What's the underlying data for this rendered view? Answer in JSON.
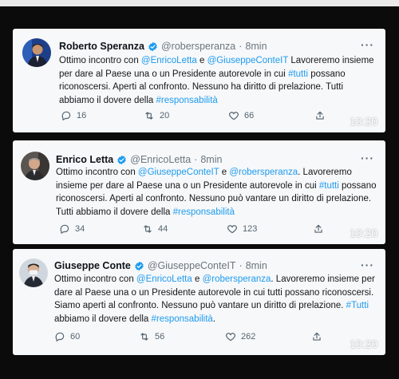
{
  "tweets": [
    {
      "name": "Roberto Speranza",
      "handle": "@robersperanza",
      "dot": "·",
      "age": "8min",
      "more": "···",
      "text": {
        "p1": "Ottimo incontro con ",
        "m1": "@EnricoLetta",
        "p2": " e ",
        "m2": "@GiuseppeConteIT",
        "p3": " Lavoreremo insieme per dare al Paese una o un Presidente autorevole in cui ",
        "h1": "#tutti",
        "p4": " possano riconoscersi. Aperti al confronto. Nessuno ha diritto di prelazione. Tutti abbiamo il dovere della ",
        "h2": "#responsabilità"
      },
      "replies": "16",
      "retweets": "20",
      "likes": "66",
      "timestamp": "10:20"
    },
    {
      "name": "Enrico Letta",
      "handle": "@EnricoLetta",
      "dot": "·",
      "age": "8min",
      "more": "···",
      "text": {
        "p1": "Ottimo incontro con ",
        "m1": "@GiuseppeConteIT",
        "p2": " e ",
        "m2": "@robersperanza",
        "p3": ". Lavoreremo insieme per dare al Paese una o un Presidente autorevole in cui ",
        "h1": "#tutti",
        "p4": " possano riconoscersi. Aperti al confronto. Nessuno può vantare un diritto di prelazione. Tutti abbiamo il dovere della ",
        "h2": "#responsabilità"
      },
      "replies": "34",
      "retweets": "44",
      "likes": "123",
      "timestamp": "10:20"
    },
    {
      "name": "Giuseppe Conte",
      "handle": "@GiuseppeConteIT",
      "dot": "·",
      "age": "8min",
      "more": "···",
      "text": {
        "p1": "Ottimo incontro con ",
        "m1": "@EnricoLetta",
        "p2": " e ",
        "m2": "@robersperanza",
        "p3": ". Lavoreremo insieme per dare al Paese una o un Presidente autorevole in cui tutti possano riconoscersi. Siamo aperti al confronto. Nessuno può vantare un diritto di prelazione. ",
        "h1": "#Tutti",
        "p4": " abbiamo il dovere della ",
        "h2": "#responsabilità",
        "p5": "."
      },
      "replies": "60",
      "retweets": "56",
      "likes": "262",
      "timestamp": "10:20"
    }
  ],
  "colors": {
    "accent": "#1d9bf0",
    "card": "#f7f8f9",
    "background": "#0b0b0b",
    "muted": "#536471"
  }
}
